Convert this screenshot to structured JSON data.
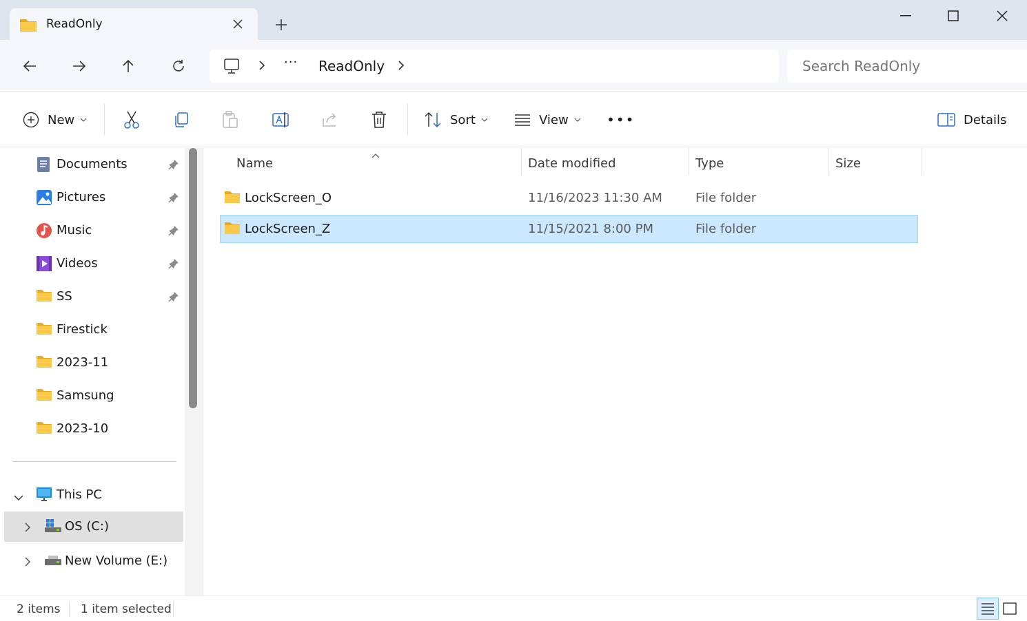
{
  "window": {
    "tab_title": "ReadOnly",
    "new_tab_symbol": "+"
  },
  "nav": {
    "breadcrumb_more": "···",
    "current_folder": "ReadOnly",
    "search_placeholder": "Search ReadOnly"
  },
  "toolbar": {
    "new_label": "New",
    "sort_label": "Sort",
    "view_label": "View",
    "more_label": "•••",
    "details_label": "Details"
  },
  "sidebar": {
    "quick_access": [
      {
        "label": "Documents",
        "icon": "documents-icon",
        "pinned": true
      },
      {
        "label": "Pictures",
        "icon": "pictures-icon",
        "pinned": true
      },
      {
        "label": "Music",
        "icon": "music-icon",
        "pinned": true
      },
      {
        "label": "Videos",
        "icon": "videos-icon",
        "pinned": true
      },
      {
        "label": "SS",
        "icon": "folder-icon",
        "pinned": true
      },
      {
        "label": "Firestick",
        "icon": "folder-icon",
        "pinned": false
      },
      {
        "label": "2023-11",
        "icon": "folder-icon",
        "pinned": false
      },
      {
        "label": "Samsung",
        "icon": "folder-icon",
        "pinned": false
      },
      {
        "label": "2023-10",
        "icon": "folder-icon",
        "pinned": false
      }
    ],
    "this_pc": "This PC",
    "drives": [
      {
        "label": "OS (C:)",
        "selected": true
      },
      {
        "label": "New Volume (E:)",
        "selected": false
      }
    ]
  },
  "columns": {
    "name": "Name",
    "date_modified": "Date modified",
    "type": "Type",
    "size": "Size"
  },
  "files": [
    {
      "name": "LockScreen_O",
      "date": "11/16/2023 11:30 AM",
      "type": "File folder",
      "size": "",
      "selected": false
    },
    {
      "name": "LockScreen_Z",
      "date": "11/15/2021 8:00 PM",
      "type": "File folder",
      "size": "",
      "selected": true
    }
  ],
  "status": {
    "item_count": "2 items",
    "selection": "1 item selected"
  },
  "colors": {
    "titlebar": "#dde4ee",
    "selection": "#cce8ff",
    "folder": "#f8c94a"
  }
}
